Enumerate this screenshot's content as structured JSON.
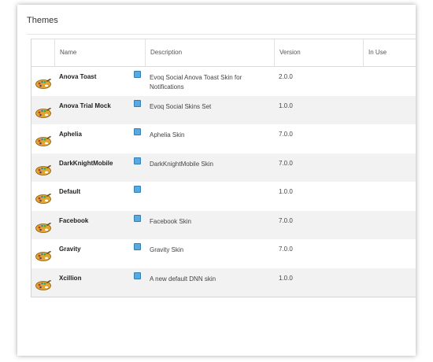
{
  "panel": {
    "title": "Themes"
  },
  "table": {
    "columns": [
      "Name",
      "Description",
      "Version",
      "In Use"
    ],
    "rows": [
      {
        "name": "Anova Toast",
        "description": "Evoq Social Anova Toast Skin for Notifications",
        "version": "2.0.0",
        "in_use": ""
      },
      {
        "name": "Anova Trial Mock",
        "description": "Evoq Social Skins Set",
        "version": "1.0.0",
        "in_use": ""
      },
      {
        "name": "Aphelia",
        "description": "Aphelia Skin",
        "version": "7.0.0",
        "in_use": ""
      },
      {
        "name": "DarkKnightMobile",
        "description": "DarkKnightMobile Skin",
        "version": "7.0.0",
        "in_use": ""
      },
      {
        "name": "Default",
        "description": "",
        "version": "1.0.0",
        "in_use": ""
      },
      {
        "name": "Facebook",
        "description": "Facebook Skin",
        "version": "7.0.0",
        "in_use": ""
      },
      {
        "name": "Gravity",
        "description": "Gravity Skin",
        "version": "7.0.0",
        "in_use": ""
      },
      {
        "name": "Xcillion",
        "description": "A new default DNN skin",
        "version": "1.0.0",
        "in_use": ""
      }
    ]
  },
  "icons": {
    "row_icon": "palette-icon",
    "info_icon": "info-icon"
  },
  "colors": {
    "alt_row": "#f2f2f2",
    "info_badge": "#5aa8dc",
    "palette": "#e2a62c"
  }
}
